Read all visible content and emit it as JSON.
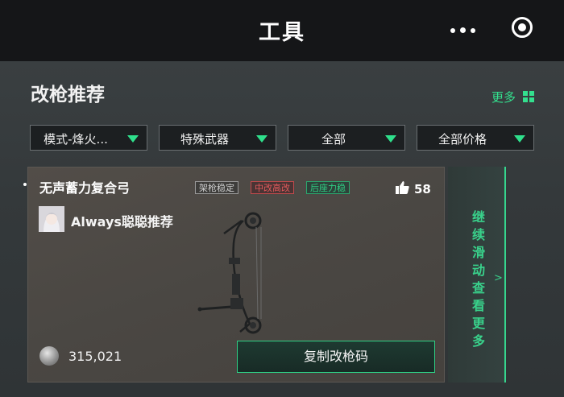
{
  "topbar": {
    "title": "工具",
    "menu_icon": "more-dots-icon",
    "target_icon": "target-circle-icon"
  },
  "section": {
    "title": "改枪推荐",
    "more_label": "更多",
    "more_icon": "grid-icon"
  },
  "filters": [
    {
      "label": "模式-烽火..."
    },
    {
      "label": "特殊武器"
    },
    {
      "label": "全部"
    },
    {
      "label": "全部价格"
    }
  ],
  "card": {
    "title": "无声蓄力复合弓",
    "tags": [
      {
        "label": "架枪稳定",
        "color": "#c9c9c9"
      },
      {
        "label": "中改高改",
        "color": "#e0595b"
      },
      {
        "label": "后座力稳",
        "color": "#2fcf84"
      }
    ],
    "likes": "58",
    "author": "Always聪聪推荐",
    "coin_value": "315,021",
    "copy_button": "复制改枪码"
  },
  "swipe": {
    "text": "继续滑动查看更多",
    "chevron": ">"
  },
  "colors": {
    "accent": "#2fe08c",
    "background": "#222528"
  }
}
